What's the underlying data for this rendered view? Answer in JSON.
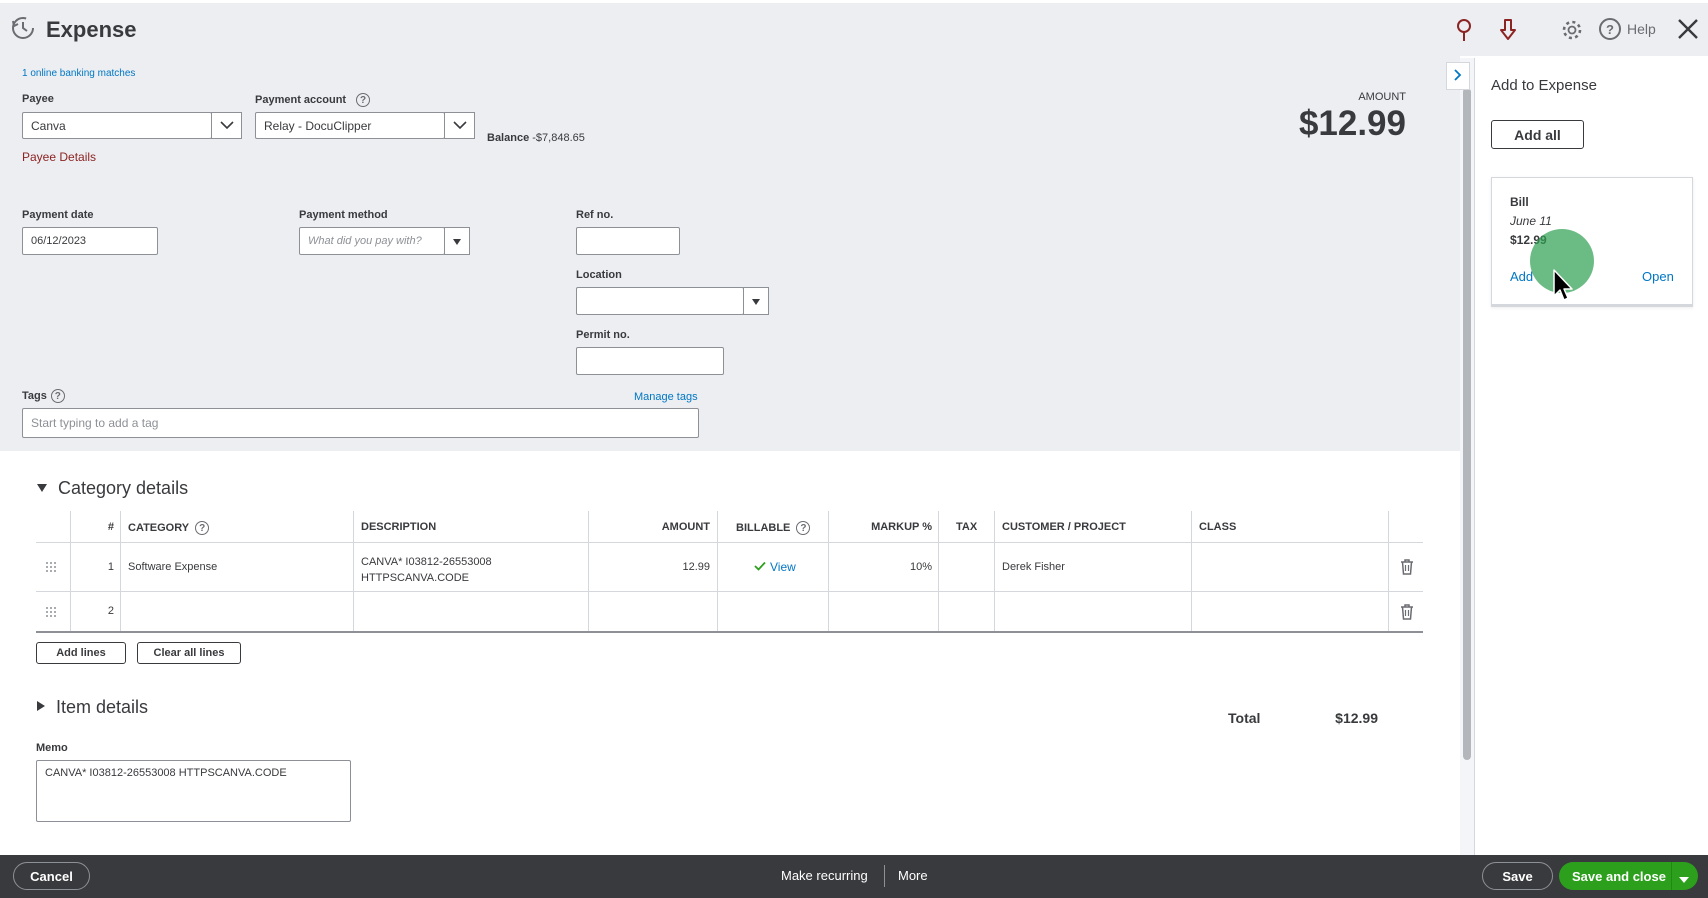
{
  "header": {
    "title": "Expense",
    "help_label": "Help"
  },
  "form": {
    "banking_matches": "1 online banking matches",
    "payee_label": "Payee",
    "payee_value": "Canva",
    "payee_details": "Payee Details",
    "payment_account_label": "Payment account",
    "payment_account_value": "Relay - DocuClipper",
    "balance_label": "Balance",
    "balance_value": "-$7,848.65",
    "amount_label": "AMOUNT",
    "amount_value": "$12.99",
    "payment_date_label": "Payment date",
    "payment_date_value": "06/12/2023",
    "payment_method_label": "Payment method",
    "payment_method_placeholder": "What did you pay with?",
    "ref_no_label": "Ref no.",
    "location_label": "Location",
    "permit_no_label": "Permit no.",
    "tags_label": "Tags",
    "manage_tags": "Manage tags",
    "tags_placeholder": "Start typing to add a tag"
  },
  "category_details": {
    "title": "Category details",
    "columns": [
      "#",
      "CATEGORY",
      "DESCRIPTION",
      "AMOUNT",
      "BILLABLE",
      "MARKUP %",
      "TAX",
      "CUSTOMER / PROJECT",
      "CLASS"
    ],
    "rows": [
      {
        "num": "1",
        "category": "Software Expense",
        "description_line1": "CANVA* I03812-26553008",
        "description_line2": "HTTPSCANVA.CODE",
        "amount": "12.99",
        "billable": "View",
        "markup": "10%",
        "tax": "",
        "customer": "Derek Fisher",
        "class": ""
      },
      {
        "num": "2",
        "category": "",
        "description_line1": "",
        "description_line2": "",
        "amount": "",
        "billable": "",
        "markup": "",
        "tax": "",
        "customer": "",
        "class": ""
      }
    ],
    "add_lines": "Add lines",
    "clear_all_lines": "Clear all lines"
  },
  "item_details": {
    "title": "Item details"
  },
  "totals": {
    "label": "Total",
    "value": "$12.99"
  },
  "memo": {
    "label": "Memo",
    "value": "CANVA* I03812-26553008 HTTPSCANVA.CODE"
  },
  "side_panel": {
    "title": "Add to Expense",
    "add_all": "Add all",
    "card": {
      "type": "Bill",
      "date": "June 11",
      "amount": "$12.99",
      "add": "Add",
      "open": "Open"
    }
  },
  "footer": {
    "cancel": "Cancel",
    "make_recurring": "Make recurring",
    "more": "More",
    "save": "Save",
    "save_and_close": "Save and close"
  },
  "colors": {
    "brand_green": "#2ca01c",
    "link_blue": "#0077c5",
    "link_red": "#8d2424",
    "footer_bg": "#393a3d"
  }
}
